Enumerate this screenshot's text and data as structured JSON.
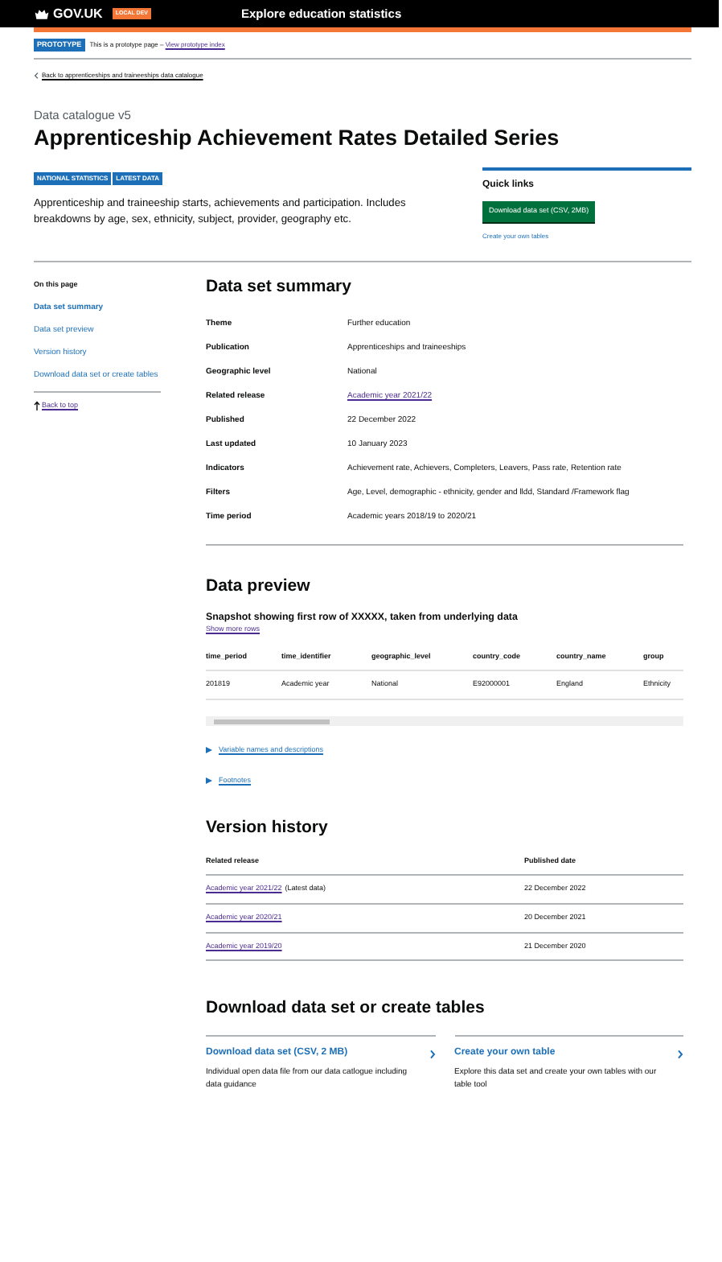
{
  "header": {
    "logo": "GOV.UK",
    "env_tag": "LOCAL DEV",
    "service_name": "Explore education statistics"
  },
  "phase_banner": {
    "tag": "PROTOTYPE",
    "text": "This is a prototype page – ",
    "link": "View prototype index"
  },
  "back_link": "Back to apprenticeships and traineeships data catalogue",
  "caption": "Data catalogue v5",
  "title": "Apprenticeship Achievement Rates Detailed Series",
  "tags": [
    "NATIONAL STATISTICS",
    "LATEST DATA"
  ],
  "description": "Apprenticeship and traineeship starts, achievements and participation. Includes breakdowns by age, sex, ethnicity, subject, provider, geography etc.",
  "quick_links": {
    "heading": "Quick links",
    "button": "Download data set (CSV, 2MB)",
    "link": "Create your own tables"
  },
  "sidebar": {
    "heading": "On this page",
    "items": [
      {
        "label": "Data set summary",
        "selected": true
      },
      {
        "label": "Data set preview",
        "selected": false
      },
      {
        "label": "Version history",
        "selected": false
      },
      {
        "label": "Download data set or create tables",
        "selected": false
      }
    ],
    "back_to_top": "Back to top"
  },
  "summary": {
    "heading": "Data set summary",
    "rows": [
      {
        "key": "Theme",
        "value": "Further education",
        "kind": "text"
      },
      {
        "key": "Publication",
        "value": "Apprenticeships and traineeships",
        "kind": "text"
      },
      {
        "key": "Geographic level",
        "value": "National",
        "kind": "text"
      },
      {
        "key": "Related release",
        "value": "Academic year 2021/22",
        "kind": "link"
      },
      {
        "key": "Published",
        "value": "22 December 2022",
        "kind": "text"
      },
      {
        "key": "Last updated",
        "value": "10 January 2023",
        "kind": "text"
      },
      {
        "key": "Indicators",
        "value": "Achievement rate, Achievers, Completers, Leavers, Pass rate, Retention rate",
        "kind": "text"
      },
      {
        "key": "Filters",
        "value": "Age, Level, demographic - ethnicity, gender and lldd, Standard /Framework flag",
        "kind": "text"
      },
      {
        "key": "Time period",
        "value": "Academic years 2018/19 to 2020/21",
        "kind": "text"
      }
    ]
  },
  "preview": {
    "heading": "Data preview",
    "subheading": "Snapshot showing first row of XXXXX, taken from underlying data",
    "show_more": "Show more rows",
    "columns": [
      "time_period",
      "time_identifier",
      "geographic_level",
      "country_code",
      "country_name",
      "group"
    ],
    "rows": [
      [
        "201819",
        "Academic year",
        "National",
        "E92000001",
        "England",
        "Ethnicity"
      ]
    ],
    "details": [
      "Variable names and descriptions",
      "Footnotes"
    ]
  },
  "versions": {
    "heading": "Version history",
    "columns": [
      "Related release",
      "Published date"
    ],
    "rows": [
      {
        "release": "Academic year 2021/22",
        "note": "(Latest data)",
        "date": "22 December 2022"
      },
      {
        "release": "Academic year 2020/21",
        "date": "20 December 2021"
      },
      {
        "release": "Academic year 2019/20",
        "date": "21 December 2020"
      }
    ]
  },
  "downloads": {
    "heading": "Download data set or create tables",
    "cards": [
      {
        "title": "Download data set (CSV, 2 MB)",
        "text": "Individual open data file from our data catlogue including data guidance"
      },
      {
        "title": "Create your own table",
        "text": "Explore this data set and create your own tables with our table tool"
      }
    ]
  }
}
